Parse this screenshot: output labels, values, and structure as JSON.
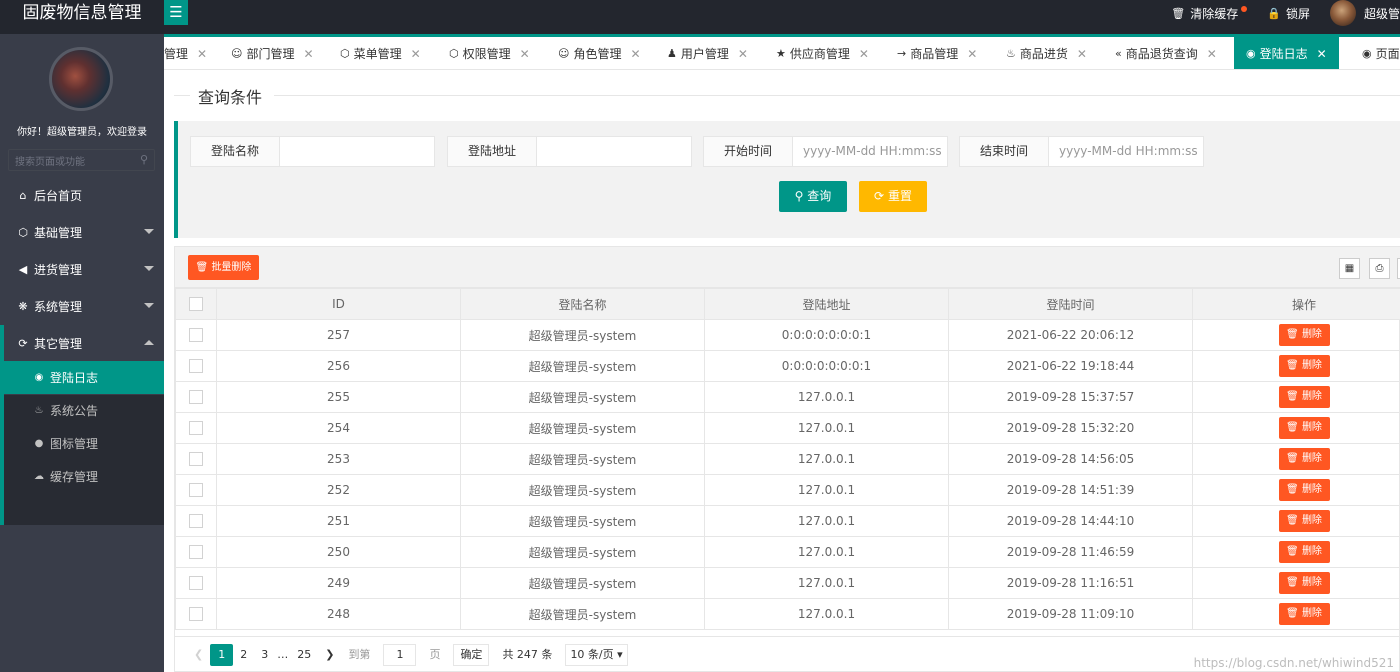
{
  "app": {
    "title": "固废物信息管理",
    "menu_icon": "hamburger-icon"
  },
  "topbar": {
    "clear_cache": "清除缓存",
    "lock": "锁屏",
    "user": "超级管"
  },
  "sidebar": {
    "welcome": "你好！超级管理员，欢迎登录",
    "search_placeholder": "搜索页面或功能",
    "items": [
      {
        "label": "后台首页",
        "icon": "home-icon"
      },
      {
        "label": "基础管理",
        "icon": "cube-icon"
      },
      {
        "label": "进货管理",
        "icon": "speaker-icon"
      },
      {
        "label": "系统管理",
        "icon": "gear-icon"
      },
      {
        "label": "其它管理",
        "icon": "circle-arrow-icon"
      }
    ],
    "subitems": [
      {
        "label": "登陆日志",
        "icon": "eye-icon"
      },
      {
        "label": "系统公告",
        "icon": "fire-icon"
      },
      {
        "label": "图标管理",
        "icon": "compass-icon"
      },
      {
        "label": "缓存管理",
        "icon": "cloud-icon"
      }
    ]
  },
  "tabs": [
    {
      "label": "管理"
    },
    {
      "label": "部门管理",
      "icon": "user-outline-icon"
    },
    {
      "label": "菜单管理",
      "icon": "cube-icon"
    },
    {
      "label": "权限管理",
      "icon": "cube-icon"
    },
    {
      "label": "角色管理",
      "icon": "smile-icon"
    },
    {
      "label": "用户管理",
      "icon": "user-icon"
    },
    {
      "label": "供应商管理",
      "icon": "star-icon"
    },
    {
      "label": "商品管理",
      "icon": "cart-icon"
    },
    {
      "label": "商品进货",
      "icon": "fire-icon"
    },
    {
      "label": "商品退货查询",
      "icon": "double-left-icon"
    },
    {
      "label": "登陆日志",
      "icon": "eye-icon"
    },
    {
      "label": "页面",
      "icon": "radio-icon"
    }
  ],
  "query": {
    "legend": "查询条件",
    "fields": [
      {
        "label": "登陆名称",
        "value": ""
      },
      {
        "label": "登陆地址",
        "value": ""
      },
      {
        "label": "开始时间",
        "placeholder": "yyyy-MM-dd HH:mm:ss"
      },
      {
        "label": "结束时间",
        "placeholder": "yyyy-MM-dd HH:mm:ss"
      }
    ],
    "search_btn": "查询",
    "reset_btn": "重置"
  },
  "table": {
    "batch_delete": "批量删除",
    "columns": [
      "ID",
      "登陆名称",
      "登陆地址",
      "登陆时间",
      "操作"
    ],
    "delete_label": "删除",
    "rows": [
      {
        "id": "257",
        "name": "超级管理员-system",
        "ip": "0:0:0:0:0:0:0:1",
        "time": "2021-06-22 20:06:12"
      },
      {
        "id": "256",
        "name": "超级管理员-system",
        "ip": "0:0:0:0:0:0:0:1",
        "time": "2021-06-22 19:18:44"
      },
      {
        "id": "255",
        "name": "超级管理员-system",
        "ip": "127.0.0.1",
        "time": "2019-09-28 15:37:57"
      },
      {
        "id": "254",
        "name": "超级管理员-system",
        "ip": "127.0.0.1",
        "time": "2019-09-28 15:32:20"
      },
      {
        "id": "253",
        "name": "超级管理员-system",
        "ip": "127.0.0.1",
        "time": "2019-09-28 14:56:05"
      },
      {
        "id": "252",
        "name": "超级管理员-system",
        "ip": "127.0.0.1",
        "time": "2019-09-28 14:51:39"
      },
      {
        "id": "251",
        "name": "超级管理员-system",
        "ip": "127.0.0.1",
        "time": "2019-09-28 14:44:10"
      },
      {
        "id": "250",
        "name": "超级管理员-system",
        "ip": "127.0.0.1",
        "time": "2019-09-28 11:46:59"
      },
      {
        "id": "249",
        "name": "超级管理员-system",
        "ip": "127.0.0.1",
        "time": "2019-09-28 11:16:51"
      },
      {
        "id": "248",
        "name": "超级管理员-system",
        "ip": "127.0.0.1",
        "time": "2019-09-28 11:09:10"
      }
    ]
  },
  "pager": {
    "pages": [
      "1",
      "2",
      "3",
      "…",
      "25"
    ],
    "goto": "到第",
    "page_value": "1",
    "page_unit": "页",
    "confirm": "确定",
    "total": "共 247 条",
    "per_page": "10 条/页"
  },
  "watermark": "https://blog.csdn.net/whiwind521"
}
